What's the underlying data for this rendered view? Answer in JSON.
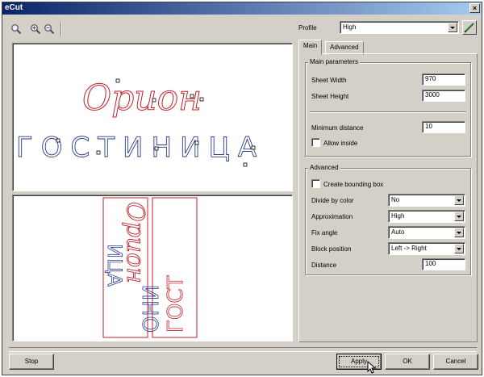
{
  "window": {
    "title": "eCut",
    "close_glyph": "×"
  },
  "toolbar": {
    "icons": [
      "zoom-icon",
      "zoom-in-icon",
      "zoom-out-icon"
    ]
  },
  "preview": {
    "top_word1": "Орион",
    "top_word2": "ГОСТИНИЦА",
    "outline_color": "#c0202a",
    "blue_color": "#2a3a8c"
  },
  "profile": {
    "label": "Profile",
    "value": "High",
    "edit_icon": "pencil-icon"
  },
  "tabs": [
    {
      "label": "Main",
      "active": true
    },
    {
      "label": "Advanced",
      "active": false
    }
  ],
  "main_parameters": {
    "title": "Main parameters",
    "sheet_width_label": "Sheet Width",
    "sheet_width_value": "970",
    "sheet_height_label": "Sheet Height",
    "sheet_height_value": "3000",
    "min_distance_label": "Minimum distance",
    "min_distance_value": "10",
    "allow_inside_label": "Allow inside",
    "allow_inside_checked": false
  },
  "advanced": {
    "title": "Advanced",
    "create_bounding_box_label": "Create bounding box",
    "create_bounding_box_checked": false,
    "divide_by_color_label": "Divide by color",
    "divide_by_color_value": "No",
    "approximation_label": "Approximation",
    "approximation_value": "High",
    "fix_angle_label": "Fix angle",
    "fix_angle_value": "Auto",
    "block_position_label": "Block position",
    "block_position_value": "Left -> Right",
    "distance_label": "Distance",
    "distance_value": "100"
  },
  "buttons": {
    "stop": "Stop",
    "apply": "Apply",
    "ok": "OK",
    "cancel": "Cancel"
  }
}
